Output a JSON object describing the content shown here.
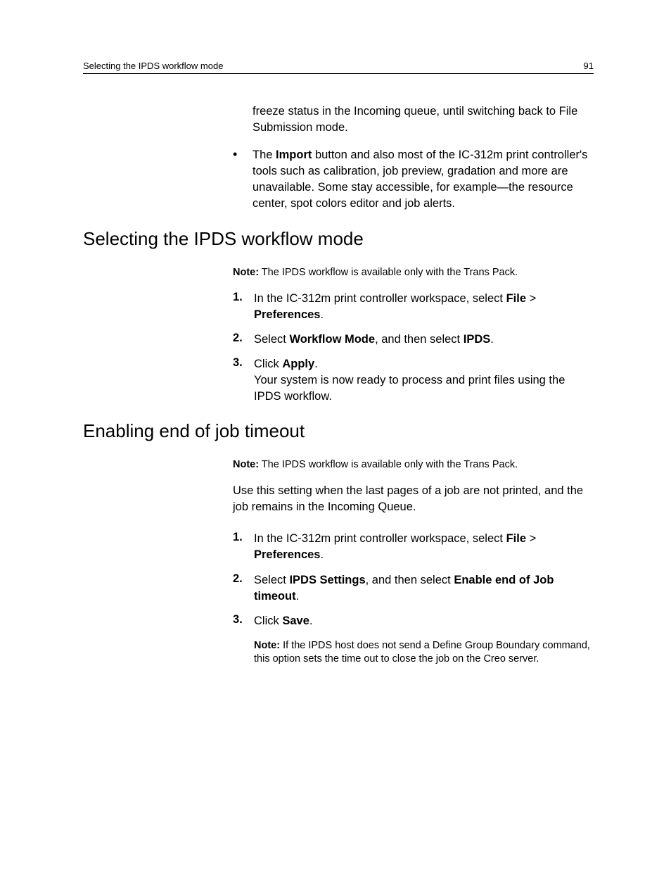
{
  "header": {
    "title": "Selecting the IPDS workflow mode",
    "page_number": "91"
  },
  "intro_bullets": {
    "bullet0_text": "freeze status in the Incoming queue, until switching back to File Submission mode.",
    "bullet1_pre": "The ",
    "bullet1_bold": "Import",
    "bullet1_post": " button and also most of the IC-312m print controller's tools such as calibration, job preview, gradation and more are unavailable. Some stay accessible, for example—the resource center, spot colors editor and job alerts."
  },
  "section1": {
    "heading": "Selecting the IPDS workflow mode",
    "note_label": "Note:",
    "note_text": " The IPDS workflow is available only with the Trans Pack.",
    "steps": {
      "s1_num": "1.",
      "s1_pre": "In the IC-312m print controller workspace, select ",
      "s1_bold1": "File",
      "s1_mid": " > ",
      "s1_bold2": "Preferences",
      "s1_post": ".",
      "s2_num": "2.",
      "s2_pre": "Select ",
      "s2_bold1": "Workflow Mode",
      "s2_mid": ", and then select ",
      "s2_bold2": "IPDS",
      "s2_post": ".",
      "s3_num": "3.",
      "s3_pre": "Click ",
      "s3_bold1": "Apply",
      "s3_post": ".",
      "s3_extra": "Your system is now ready to process and print files using the IPDS workflow."
    }
  },
  "section2": {
    "heading": "Enabling end of job timeout",
    "note_label": "Note:",
    "note_text": " The IPDS workflow is available only with the Trans Pack.",
    "intro": "Use this setting when the last pages of a job are not printed, and the job remains in the Incoming Queue.",
    "steps": {
      "s1_num": "1.",
      "s1_pre": "In the IC-312m print controller workspace, select ",
      "s1_bold1": "File",
      "s1_mid": " > ",
      "s1_bold2": "Preferences",
      "s1_post": ".",
      "s2_num": "2.",
      "s2_pre": "Select ",
      "s2_bold1": "IPDS Settings",
      "s2_mid": ", and then select ",
      "s2_bold2": "Enable end of Job timeout",
      "s2_post": ".",
      "s3_num": "3.",
      "s3_pre": "Click ",
      "s3_bold1": "Save",
      "s3_post": "."
    },
    "inner_note_label": "Note:",
    "inner_note_text": " If the IPDS host does not send a Define Group Boundary command, this option sets the time out to close the job on the Creo server."
  }
}
